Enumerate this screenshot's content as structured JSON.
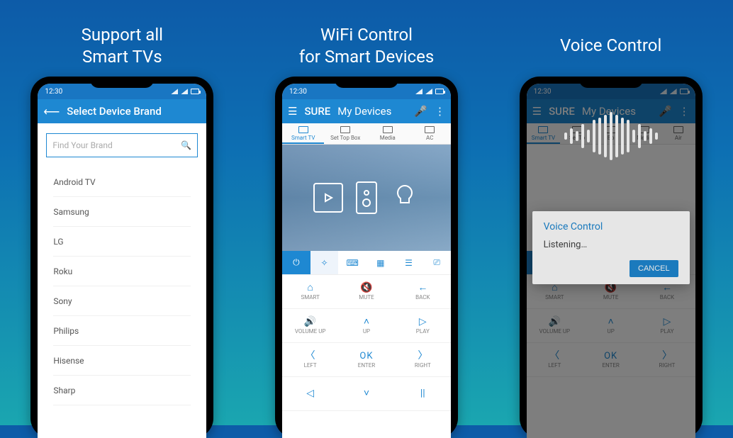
{
  "promo": {
    "screen1": "Support all\nSmart TVs",
    "screen2": "WiFi Control\nfor Smart Devices",
    "screen3": "Voice Control"
  },
  "status": {
    "time": "12:30"
  },
  "screen1": {
    "title": "Select Device Brand",
    "search_placeholder": "Find Your Brand",
    "brands": [
      "Android TV",
      "Samsung",
      "LG",
      "Roku",
      "Sony",
      "Philips",
      "Hisense",
      "Sharp"
    ]
  },
  "screen2": {
    "app_name": "SURE",
    "section": "My Devices",
    "tabs": [
      "Smart TV",
      "Set Top Box",
      "Media",
      "AC"
    ],
    "remote_buttons": [
      {
        "glyph": "⌂",
        "label": "SMART"
      },
      {
        "glyph": "🔇",
        "label": "MUTE"
      },
      {
        "glyph": "←",
        "label": "BACK"
      },
      {
        "glyph": "🔊",
        "label": "VOLUME UP"
      },
      {
        "glyph": "˄",
        "label": "UP"
      },
      {
        "glyph": "▷",
        "label": "PLAY"
      },
      {
        "glyph": "〈",
        "label": "LEFT"
      },
      {
        "glyph": "OK",
        "label": "ENTER"
      },
      {
        "glyph": "〉",
        "label": "RIGHT"
      },
      {
        "glyph": "◁",
        "label": ""
      },
      {
        "glyph": "˅",
        "label": ""
      },
      {
        "glyph": "||",
        "label": ""
      }
    ]
  },
  "screen3": {
    "app_name": "SURE",
    "section": "My Devices",
    "tabs": [
      "Smart TV",
      "Set To",
      "Bo",
      "Media",
      "Air"
    ],
    "dialog_title": "Voice Control",
    "dialog_body": "Listening…",
    "cancel": "CANCEL",
    "remote_buttons": [
      {
        "glyph": "⌂",
        "label": "SMART"
      },
      {
        "glyph": "🔇",
        "label": "MUTE"
      },
      {
        "glyph": "←",
        "label": "BACK"
      },
      {
        "glyph": "🔊",
        "label": "VOLUME UP"
      },
      {
        "glyph": "˄",
        "label": "UP"
      },
      {
        "glyph": "▷",
        "label": "PLAY"
      },
      {
        "glyph": "〈",
        "label": "LEFT"
      },
      {
        "glyph": "OK",
        "label": "ENTER"
      },
      {
        "glyph": "〉",
        "label": "RIGHT"
      }
    ]
  }
}
